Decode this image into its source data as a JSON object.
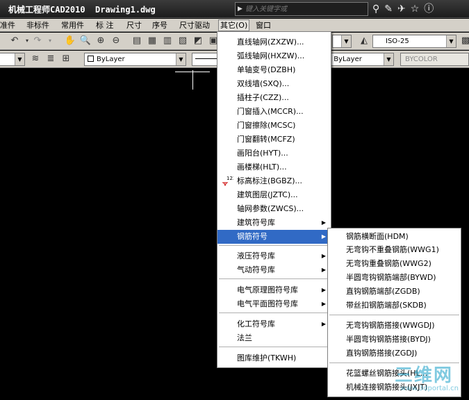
{
  "titlebar": {
    "title": "机械工程师CAD2010  Drawing1.dwg",
    "search_placeholder": "键入关键字或",
    "icons": [
      "binoculars-icon",
      "tools-icon",
      "satellite-icon",
      "star-icon",
      "help-icon"
    ]
  },
  "menubar": {
    "items": [
      "准件",
      "非标件",
      "常用件",
      "标 注",
      "尺寸",
      "序号",
      "尺寸驱动",
      "其它(O)",
      "窗口"
    ],
    "active": "其它(O)"
  },
  "toolbar1": {
    "icons": [
      "undo-icon",
      "redo-icon",
      "pan-icon",
      "zoom-icon",
      "zoom-window-icon",
      "zoom-previous-icon",
      "properties-icon",
      "design-center-icon",
      "tool-palette-icon",
      "sheetset-icon",
      "markup-icon",
      "calculator-icon"
    ],
    "dimstyle_value": "ISO-25"
  },
  "toolbar2": {
    "layer_value": "ByLayer",
    "linetype_value": "ByLayer",
    "color_value": "BYCOLOR"
  },
  "menu_main": {
    "items": [
      {
        "label": "直线轴网(ZXZW)...",
        "submenu": false
      },
      {
        "label": "弧线轴网(HXZW)...",
        "submenu": false
      },
      {
        "label": "单轴变号(DZBH)",
        "submenu": false
      },
      {
        "label": "双线墙(SXQ)...",
        "submenu": false
      },
      {
        "label": "插柱子(CZZ)...",
        "submenu": false
      },
      {
        "label": "门窗插入(MCCR)...",
        "submenu": false
      },
      {
        "label": "门窗擦除(MCSC)",
        "submenu": false
      },
      {
        "label": "门窗翻转(MCFZ)",
        "submenu": false
      },
      {
        "label": "画阳台(HYT)...",
        "submenu": false
      },
      {
        "label": "画楼梯(HLT)...",
        "submenu": false
      },
      {
        "label": "标高标注(BGBZ)...",
        "submenu": false,
        "mark": "123"
      },
      {
        "label": "建筑图层(JZTC)...",
        "submenu": false
      },
      {
        "label": "轴网参数(ZWCS)...",
        "submenu": false
      },
      {
        "label": "建筑符号库",
        "submenu": true
      },
      {
        "label": "钢筋符号",
        "submenu": true,
        "highlighted": true
      },
      {
        "label": "液压符号库",
        "submenu": true
      },
      {
        "label": "气动符号库",
        "submenu": true
      },
      {
        "label": "电气原理图符号库",
        "submenu": true
      },
      {
        "label": "电气平面图符号库",
        "submenu": true
      },
      {
        "label": "化工符号库",
        "submenu": true
      },
      {
        "label": "法兰",
        "submenu": false
      },
      {
        "label": "图库维护(TKWH)",
        "submenu": false
      }
    ]
  },
  "menu_rebar": {
    "items": [
      "钢筋横断面(HDM)",
      "无弯钩不重叠钢筋(WWG1)",
      "无弯钩重叠钢筋(WWG2)",
      "半圆弯钩钢筋端部(BYWD)",
      "直钩钢筋端部(ZGDB)",
      "带丝扣钢筋端部(SKDB)",
      "无弯钩钢筋搭接(WWGDJ)",
      "半圆弯钩钢筋搭接(BYDJ)",
      "直钩钢筋搭接(ZGDJ)",
      "花篮螺丝钢筋接头(HL...",
      "机械连接钢筋接头(JXJT)"
    ]
  },
  "watermark": {
    "big": "三维网",
    "small": "www.3dportal.cn"
  }
}
